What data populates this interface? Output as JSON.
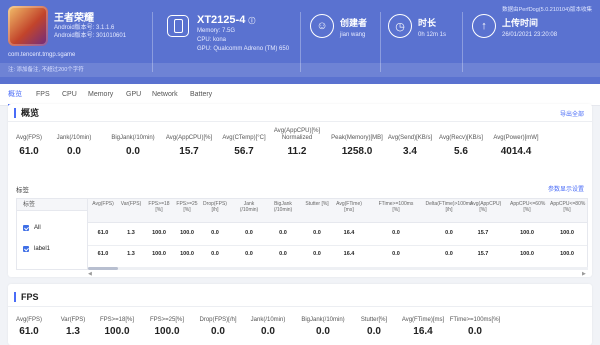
{
  "app": {
    "name": "王者荣耀",
    "android_version": "Android版本号: 3.1.1.6",
    "android_code": "Android版本号: 301010601",
    "package": "com.tencent.tmgp.sgame"
  },
  "device": {
    "name": "XT2125-4",
    "memory": "Memory: 7.5G",
    "cpu": "CPU: kona",
    "gpu": "GPU: Qualcomm Adreno (TM) 650"
  },
  "stats": [
    {
      "label": "创建者",
      "value": "jian wang",
      "icon": "user-icon",
      "glyph": "☺"
    },
    {
      "label": "时长",
      "value": "0h 12m 1s",
      "icon": "clock-icon",
      "glyph": "◷"
    },
    {
      "label": "上传时间",
      "value": "26/01/2021 23:20:08",
      "icon": "upload-icon",
      "glyph": "↑"
    }
  ],
  "top_note": "数据由PerfDog(5.0.210104)版本收集",
  "notice": "注: 添加备注, 不超过200个字符",
  "nav_tabs": [
    "概览",
    "FPS",
    "CPU",
    "Memory",
    "GPU",
    "Network",
    "Battery"
  ],
  "overview": {
    "title": "概览",
    "export": "导出全部",
    "metrics": [
      {
        "label": "Avg(FPS)",
        "value": "61.0"
      },
      {
        "label": "Jank(/10min)",
        "value": "0.0"
      },
      {
        "label": "BigJank(/10min)",
        "value": "0.0"
      },
      {
        "label": "Avg(AppCPU)[%]",
        "value": "15.7"
      },
      {
        "label": "Avg(CTemp)[°C]",
        "value": "56.7"
      },
      {
        "label": "Avg(AppCPU)[%] Normalized",
        "value": "11.2"
      },
      {
        "label": "Peak(Memory)[MB]",
        "value": "1258.0"
      },
      {
        "label": "Avg(Send)[KB/s]",
        "value": "3.4"
      },
      {
        "label": "Avg(Recv)[KB/s]",
        "value": "5.6"
      },
      {
        "label": "Avg(Power)[mW]",
        "value": "4014.4"
      }
    ],
    "label_section": "标签",
    "settings_link": "参数显示设置",
    "label_col_header": "标签",
    "labels": [
      "All",
      "label1"
    ],
    "columns": [
      "Avg(FPS)",
      "Var(FPS)",
      "FPS>=18 [%]",
      "FPS>=25 [%]",
      "Drop(FPS) [/h]",
      "Jank (/10min)",
      "BigJank (/10min)",
      "Stutter [%]",
      "Avg(FTime) [ms]",
      "FTime>=100ms [%]",
      "Delta(FTime)>100ms [/h]",
      "Avg(AppCPU) [%]",
      "AppCPU<=60% [%]",
      "AppCPU<=80% [%]"
    ],
    "rows": [
      [
        "61.0",
        "1.3",
        "100.0",
        "100.0",
        "0.0",
        "0.0",
        "0.0",
        "0.0",
        "16.4",
        "0.0",
        "0.0",
        "15.7",
        "100.0",
        "100.0"
      ],
      [
        "61.0",
        "1.3",
        "100.0",
        "100.0",
        "0.0",
        "0.0",
        "0.0",
        "0.0",
        "16.4",
        "0.0",
        "0.0",
        "15.7",
        "100.0",
        "100.0"
      ]
    ]
  },
  "fps_card": {
    "title": "FPS",
    "metrics": [
      {
        "label": "Avg(FPS)",
        "value": "61.0"
      },
      {
        "label": "Var(FPS)",
        "value": "1.3"
      },
      {
        "label": "FPS>=18[%]",
        "value": "100.0"
      },
      {
        "label": "FPS>=25[%]",
        "value": "100.0"
      },
      {
        "label": "Drop(FPS)[/h]",
        "value": "0.0"
      },
      {
        "label": "Jank(/10min)",
        "value": "0.0"
      },
      {
        "label": "BigJank(/10min)",
        "value": "0.0"
      },
      {
        "label": "Stutter[%]",
        "value": "0.0"
      },
      {
        "label": "Avg(FTime)[ms]",
        "value": "16.4"
      },
      {
        "label": "FTime>=100ms[%]",
        "value": "0.0"
      }
    ]
  }
}
